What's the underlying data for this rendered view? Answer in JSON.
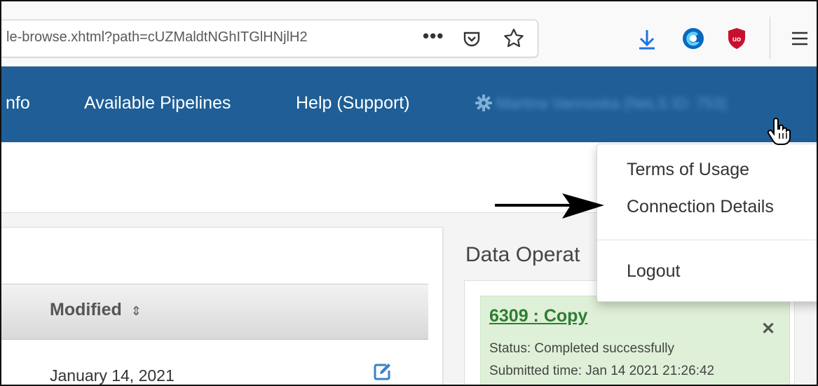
{
  "browser": {
    "url": "le-browse.xhtml?path=cUZMaldtNGhITGlHNjlH2",
    "more_label": "•••"
  },
  "nav": {
    "items": [
      {
        "label": "nfo"
      },
      {
        "label": "Available Pipelines"
      },
      {
        "label": "Help (Support)"
      }
    ],
    "user_label": "Martina Vannoska (NeLS ID: 753)"
  },
  "table": {
    "modified_header": "Modified",
    "sort_glyph": "⇕",
    "rows": [
      {
        "modified": "January 14, 2021"
      }
    ]
  },
  "data_operations": {
    "title": "Data Operat",
    "operation": {
      "title": "6309 : Copy",
      "close_label": "✕",
      "status": "Status: Completed successfully",
      "submitted": "Submitted time: Jan 14 2021 21:26:42"
    }
  },
  "user_menu": {
    "items": [
      {
        "label": "Terms of Usage"
      },
      {
        "label": "Connection Details"
      },
      {
        "label": "Logout"
      }
    ]
  },
  "colors": {
    "navbar": "#1f5e96",
    "op_card_bg": "#dff0d8",
    "op_title": "#2e7d32",
    "download_icon": "#1a73e8",
    "ublock": "#c8102e"
  },
  "icons": [
    "pocket-icon",
    "bookmark-star-icon",
    "download-icon",
    "browser-extension-icon",
    "ublock-icon",
    "hamburger-menu-icon",
    "gear-icon",
    "edit-icon",
    "hand-cursor-icon",
    "arrow-annotation"
  ]
}
